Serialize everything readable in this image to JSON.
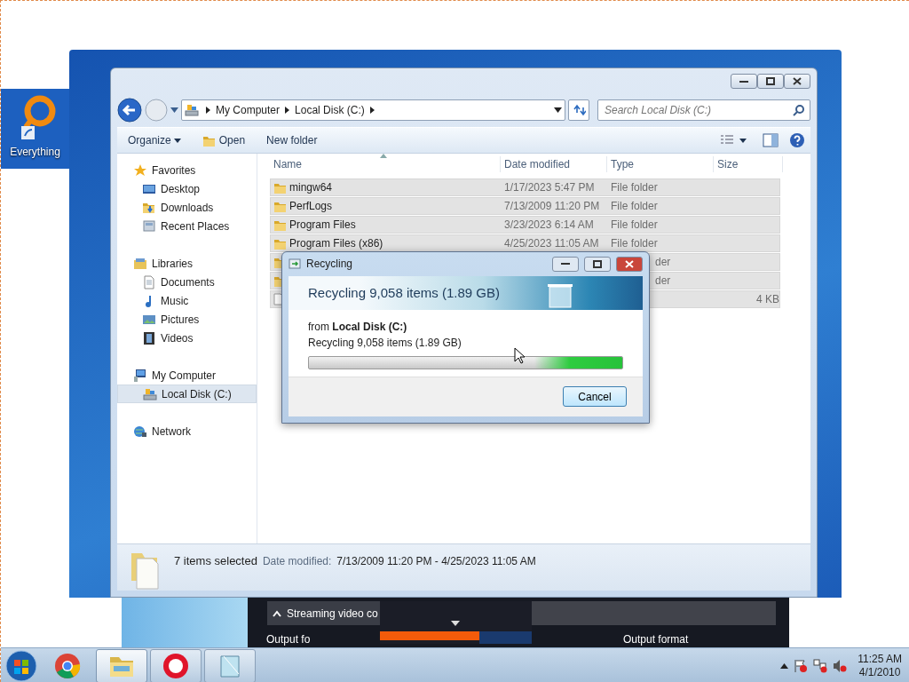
{
  "desktop_icon": {
    "label": "Everything"
  },
  "explorer": {
    "address": [
      "My Computer",
      "Local Disk (C:)"
    ],
    "search": {
      "placeholder": "Search Local Disk (C:)"
    },
    "toolbar": [
      {
        "label": "Organize",
        "kind": "menu"
      },
      {
        "label": "Open",
        "kind": "open"
      },
      {
        "label": "New folder",
        "kind": "plain"
      }
    ],
    "columns": [
      "Name",
      "Date modified",
      "Type",
      "Size"
    ],
    "nav": [
      {
        "label": "Favorites",
        "kind": "star",
        "selected": false,
        "children": [
          {
            "label": "Desktop",
            "kind": "desktop",
            "selected": false
          },
          {
            "label": "Downloads",
            "kind": "downloads",
            "selected": false
          },
          {
            "label": "Recent Places",
            "kind": "recent",
            "selected": false
          }
        ]
      },
      {
        "label": "Libraries",
        "kind": "library",
        "selected": false,
        "children": [
          {
            "label": "Documents",
            "kind": "document",
            "selected": false
          },
          {
            "label": "Music",
            "kind": "music",
            "selected": false
          },
          {
            "label": "Pictures",
            "kind": "pictures",
            "selected": false
          },
          {
            "label": "Videos",
            "kind": "videos",
            "selected": false
          }
        ]
      },
      {
        "label": "My Computer",
        "kind": "computer",
        "selected": false,
        "children": [
          {
            "label": "Local Disk (C:)",
            "kind": "disk",
            "selected": true
          }
        ]
      },
      {
        "label": "Network",
        "kind": "network",
        "selected": false
      }
    ],
    "rows": [
      {
        "kind": "folder",
        "name": "mingw64",
        "date": "1/17/2023 5:47 PM",
        "type": "File folder",
        "selected": true
      },
      {
        "kind": "folder",
        "name": "PerfLogs",
        "date": "7/13/2009 11:20 PM",
        "type": "File folder",
        "selected": true
      },
      {
        "kind": "folder",
        "name": "Program Files",
        "date": "3/23/2023 6:14 AM",
        "type": "File folder",
        "selected": true
      },
      {
        "kind": "folder",
        "name": "Program Files (x86)",
        "date": "4/25/2023 11:05 AM",
        "type": "File folder",
        "selected": true
      },
      {
        "kind": "folder",
        "type": "der",
        "selected": true
      },
      {
        "kind": "folder",
        "type": "der",
        "selected": true
      },
      {
        "kind": "file",
        "size": "4 KB",
        "selected": true
      }
    ],
    "details": {
      "count": "7 items selected",
      "label": "Date modified:",
      "value": "7/13/2009 11:20 PM - 4/25/2023 11:05 AM"
    }
  },
  "dialog": {
    "title": "Recycling",
    "heading": "Recycling 9,058 items (1.89 GB)",
    "from_line": "from **Local Disk (C:)**",
    "status": "Recycling 9,058 items (1.89 GB)",
    "level": 0.28,
    "button": "Cancel"
  },
  "background_app": {
    "section": "Streaming video co",
    "labels": [
      "Output fo",
      "Output format"
    ]
  },
  "taskbar": {
    "apps": [
      {
        "kind": "chrome",
        "selected": false
      },
      {
        "kind": "explorer",
        "selected": true
      },
      {
        "kind": "record",
        "selected": false
      },
      {
        "kind": "notepad",
        "selected": false
      }
    ],
    "time": "11:25 AM",
    "date": "4/1/2010"
  }
}
